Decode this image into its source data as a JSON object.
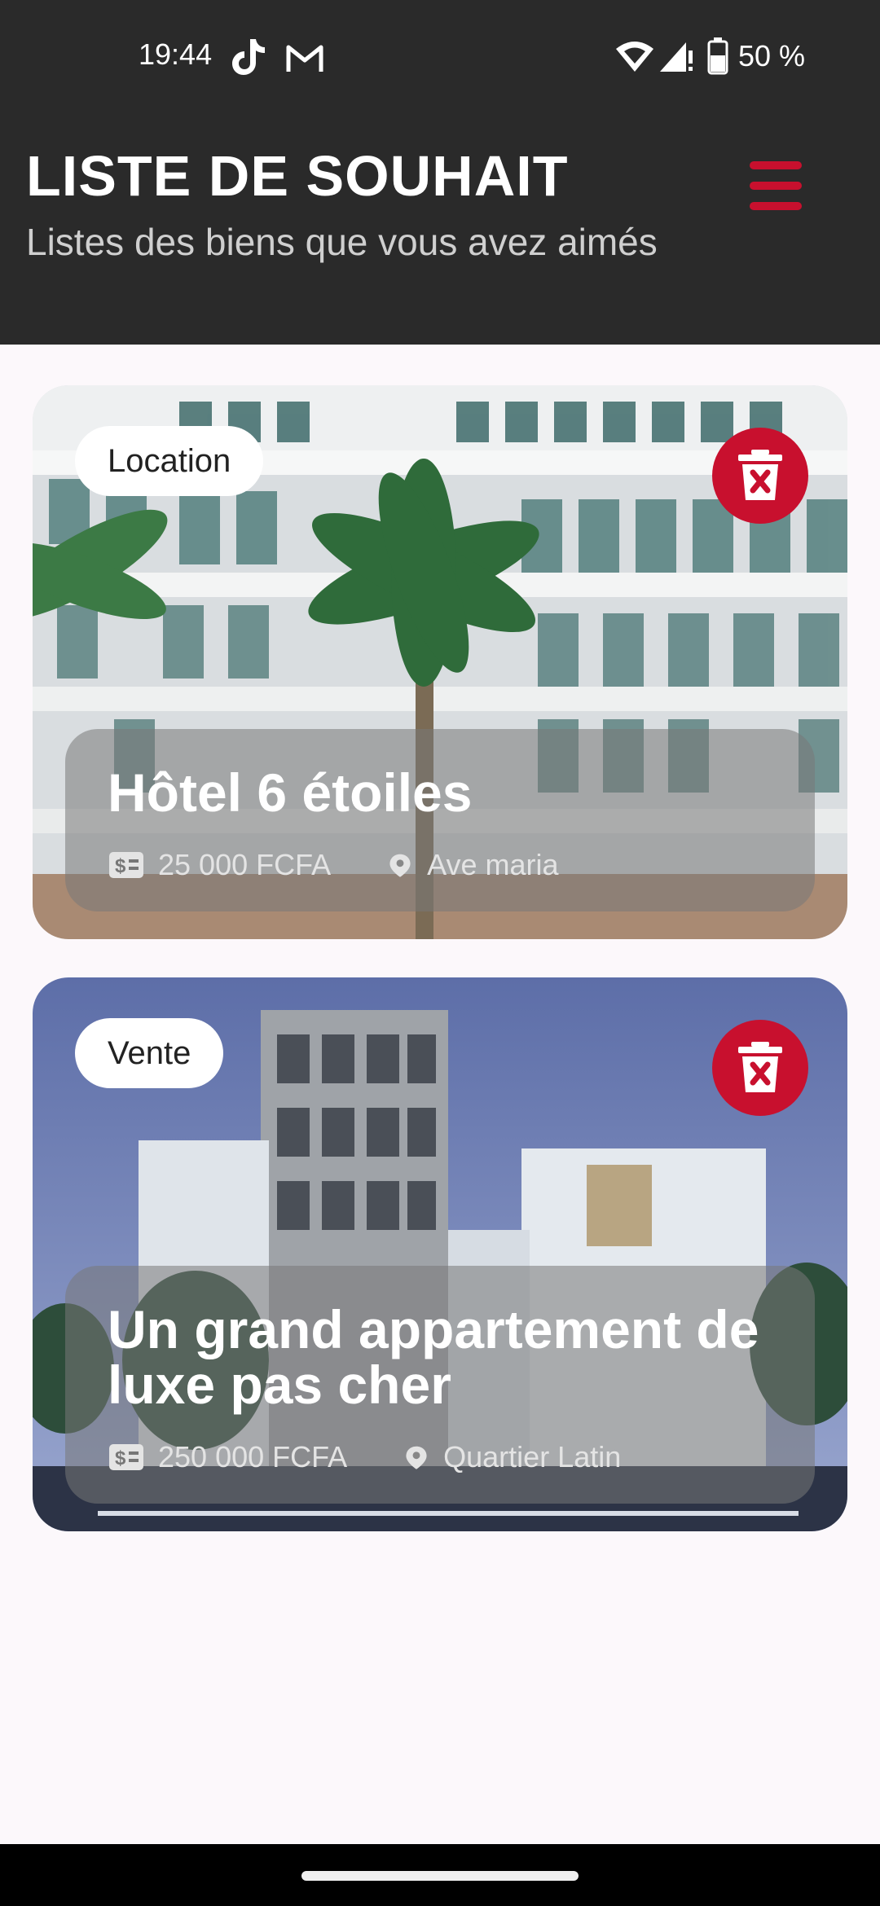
{
  "status_bar": {
    "time": "19:44",
    "battery": "50 %",
    "icons": [
      "tiktok-icon",
      "gmail-icon",
      "wifi-icon",
      "signal-icon",
      "battery-icon"
    ]
  },
  "header": {
    "title": "LISTE DE SOUHAIT",
    "subtitle": "Listes des biens que vous avez aimés",
    "menu_icon": "hamburger-menu-icon",
    "accent_color": "#c8102e",
    "background_color": "#2a2a2a"
  },
  "wishlist": [
    {
      "type": "Location",
      "title": "Hôtel 6 étoiles",
      "price": "25 000 FCFA",
      "location": "Ave maria",
      "delete_icon": "trash-icon"
    },
    {
      "type": "Vente",
      "title": "Un grand appartement de luxe pas cher",
      "price": "250 000 FCFA",
      "location": "Quartier Latin",
      "delete_icon": "trash-icon"
    }
  ],
  "page_background": "#fcf8fb"
}
